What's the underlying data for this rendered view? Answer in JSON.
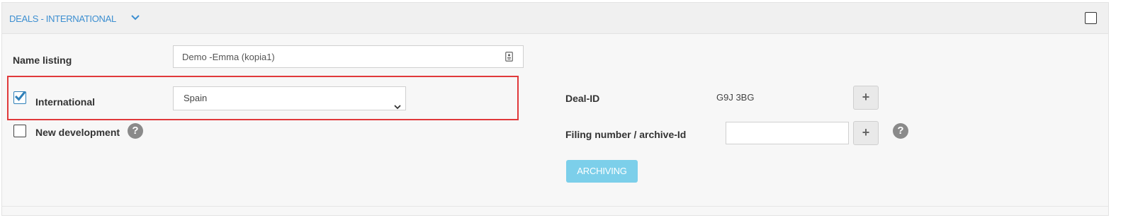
{
  "section": {
    "title": "DEALS - INTERNATIONAL",
    "expand_icon": "chevron-down-icon",
    "select_checked": false
  },
  "form": {
    "name_listing": {
      "label": "Name listing",
      "value": "Demo -Emma (kopia1)",
      "icon": "contact-card-icon"
    },
    "international": {
      "label": "International",
      "checked": true,
      "country_selected": "Spain"
    },
    "new_development": {
      "label": "New development",
      "checked": false,
      "help_icon": "question-circle-icon"
    },
    "deal_id": {
      "label": "Deal-ID",
      "value": "G9J 3BG",
      "button_icon": "plus-icon"
    },
    "filing_number": {
      "label": "Filing number / archive-Id",
      "value": "",
      "button_icon": "plus-icon",
      "help_icon": "question-circle-icon"
    },
    "archiving_button": "ARCHIVING"
  },
  "colors": {
    "accent_blue": "#3d8fd1",
    "highlight_red": "#e0393b",
    "archiving_button": "#7ccfea",
    "check_blue": "#2e7fb8"
  }
}
